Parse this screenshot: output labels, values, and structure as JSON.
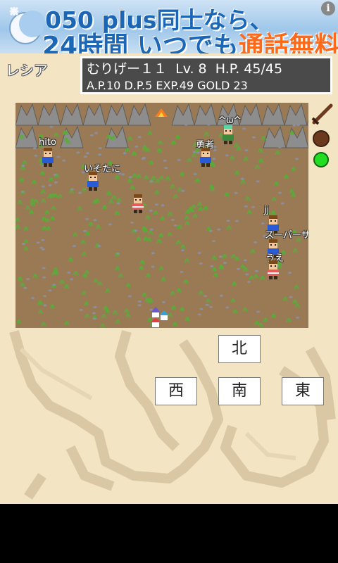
{
  "ad": {
    "line1": "050 plus同士なら、",
    "line2_a": "24時間 いつでも",
    "line2_b": "通話無料！",
    "info": "i"
  },
  "town": "レシア",
  "stats": {
    "name": "むりげー１１",
    "level": "Lv.  8",
    "hp": "H.P. 45/45",
    "line2": "A.P.10 D.P.5 EXP.49 GOLD 23"
  },
  "players": [
    {
      "name": "hito",
      "shirt": "#2a5bd7"
    },
    {
      "name": "いそたに",
      "shirt": "#2a5bd7"
    },
    {
      "name": "勇者",
      "shirt": "#2a5bd7"
    },
    {
      "name": "^ω^",
      "shirt": "#3a8a3a"
    },
    {
      "name": "jj",
      "shirt": "#2a5bd7"
    },
    {
      "name": "スーパーサイ",
      "shirt": "#2a5bd7"
    },
    {
      "name": "うえ",
      "shirt": "#2a5bd7"
    }
  ],
  "nav": {
    "north": "北",
    "west": "西",
    "south": "南",
    "east": "東"
  },
  "colors": {
    "field": "#9a7a55",
    "panel": "#4a4a4a",
    "accent": "#1b66b5"
  }
}
